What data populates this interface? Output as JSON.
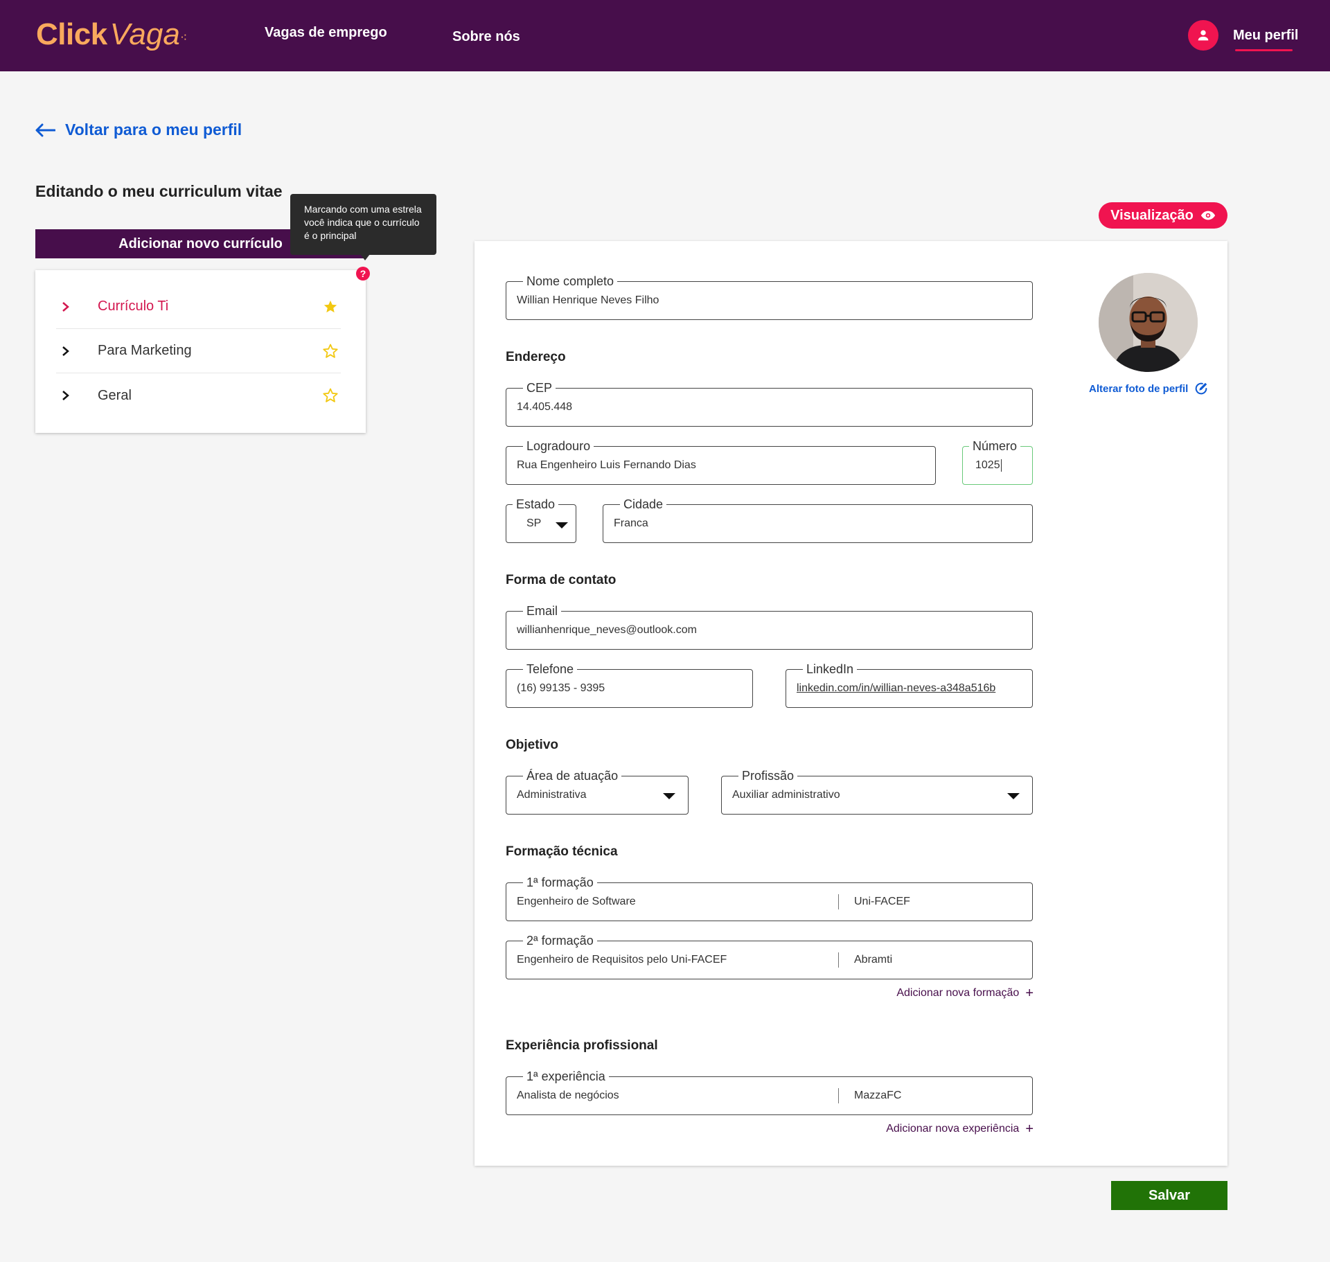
{
  "header": {
    "logo_bold": "Click",
    "logo_italic": "Vaga",
    "nav": [
      "Vagas de emprego",
      "Sobre nós"
    ],
    "profile_label": "Meu perfil",
    "background": "#470e4b",
    "accent": "#f01450",
    "logo_color": "#f9a95d"
  },
  "back_link": "Voltar para o meu perfil",
  "page_title": "Editando o meu curriculum vitae",
  "add_cv_button": "Adicionar novo currículo",
  "tooltip": "Marcando com uma estrela você indica que o currículo é o principal",
  "cv_list": [
    {
      "label": "Currículo Ti",
      "starred": true
    },
    {
      "label": "Para Marketing",
      "starred": false
    },
    {
      "label": "Geral",
      "starred": false
    }
  ],
  "preview_button": "Visualização",
  "form": {
    "nome": {
      "label": "Nome completo",
      "value": "Willian Henrique Neves Filho"
    },
    "endereco_title": "Endereço",
    "cep": {
      "label": "CEP",
      "value": "14.405.448"
    },
    "logradouro": {
      "label": "Logradouro",
      "value": "Rua Engenheiro Luis Fernando Dias"
    },
    "numero": {
      "label": "Número",
      "value": "1025"
    },
    "estado": {
      "label": "Estado",
      "value": "SP"
    },
    "cidade": {
      "label": "Cidade",
      "value": "Franca"
    },
    "contato_title": "Forma de contato",
    "email": {
      "label": "Email",
      "value": "willianhenrique_neves@outlook.com"
    },
    "telefone": {
      "label": "Telefone",
      "value": "(16) 99135 - 9395"
    },
    "linkedin": {
      "label": "LinkedIn",
      "value": "linkedin.com/in/willian-neves-a348a516b"
    },
    "objetivo_title": "Objetivo",
    "area": {
      "label": "Área de atuação",
      "value": "Administrativa"
    },
    "profissao": {
      "label": "Profissão",
      "value": "Auxiliar administrativo"
    },
    "formacao_title": "Formação técnica",
    "formacoes": [
      {
        "label": "1ª formação",
        "course": "Engenheiro de Software",
        "institution": "Uni-FACEF"
      },
      {
        "label": "2ª formação",
        "course": "Engenheiro de Requisitos pelo Uni-FACEF",
        "institution": "Abramti"
      }
    ],
    "add_formacao": "Adicionar nova formação",
    "experiencia_title": "Experiência profissional",
    "experiencias": [
      {
        "label": "1ª experiência",
        "role": "Analista de negócios",
        "company": "MazzaFC"
      }
    ],
    "add_experiencia": "Adicionar nova experiência"
  },
  "change_photo": "Alterar foto de perfil",
  "save_button": "Salvar"
}
